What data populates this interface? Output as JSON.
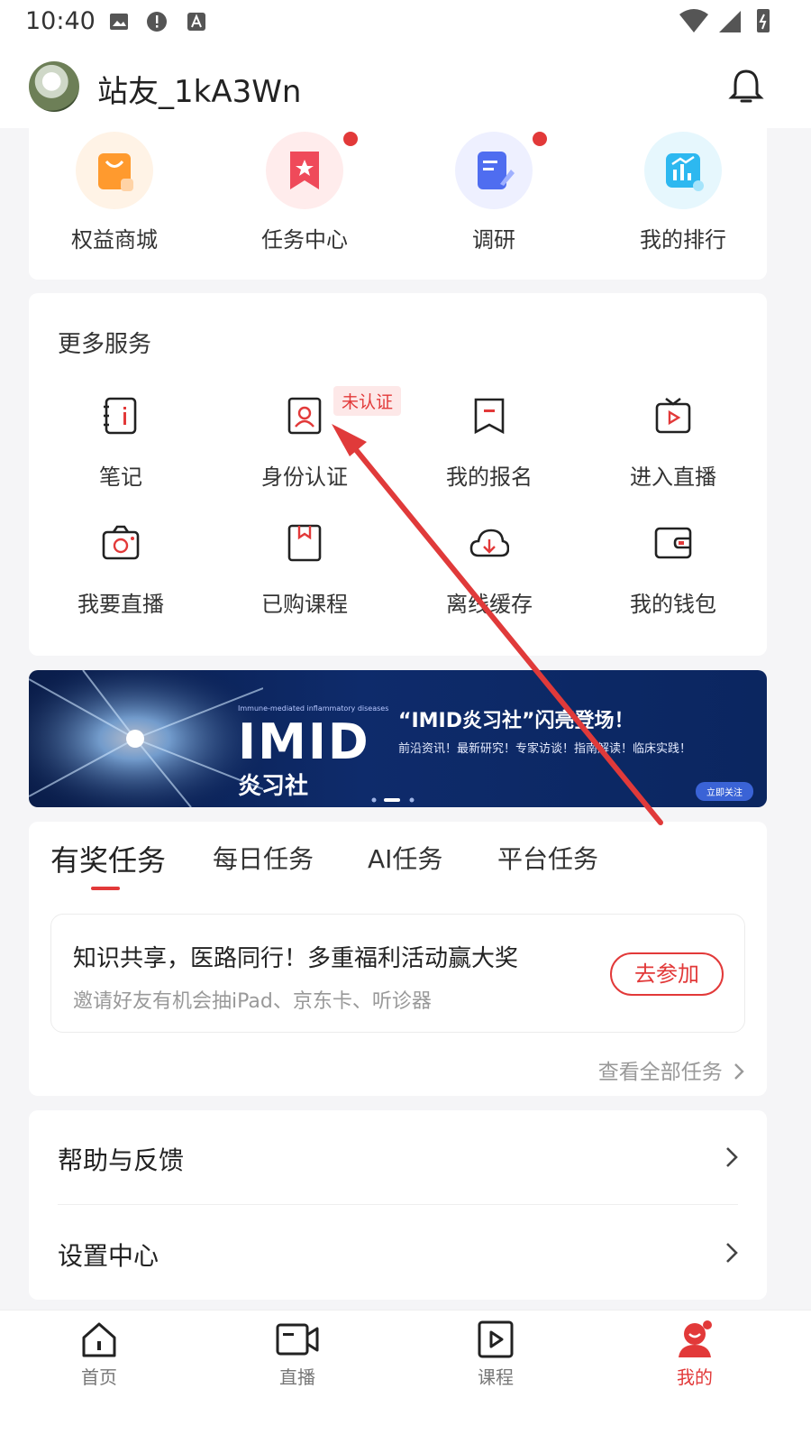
{
  "status_bar": {
    "time": "10:40"
  },
  "header": {
    "username": "站友_1kA3Wn"
  },
  "quick_actions": [
    {
      "label": "权益商城",
      "icon": "shopping-bag-icon"
    },
    {
      "label": "任务中心",
      "icon": "bookmark-star-icon"
    },
    {
      "label": "调研",
      "icon": "survey-edit-icon"
    },
    {
      "label": "我的排行",
      "icon": "ranking-chart-icon"
    }
  ],
  "more_services": {
    "title": "更多服务",
    "badge": "未认证",
    "items": [
      {
        "label": "笔记",
        "icon": "notebook-icon"
      },
      {
        "label": "身份认证",
        "icon": "id-card-icon"
      },
      {
        "label": "我的报名",
        "icon": "registration-icon"
      },
      {
        "label": "进入直播",
        "icon": "tv-play-icon"
      },
      {
        "label": "我要直播",
        "icon": "camera-icon"
      },
      {
        "label": "已购课程",
        "icon": "course-book-icon"
      },
      {
        "label": "离线缓存",
        "icon": "cloud-download-icon"
      },
      {
        "label": "我的钱包",
        "icon": "wallet-icon"
      }
    ]
  },
  "banner": {
    "top_line": "Immune-mediated inflammatory diseases",
    "logo": "IMID",
    "logo_sub": "炎习社",
    "headline": "“IMID炎习社”闪亮登场！",
    "desc": "前沿资讯！最新研究！专家访谈！指南解读！临床实践！",
    "button": "立即关注"
  },
  "tasks": {
    "tabs": [
      "有奖任务",
      "每日任务",
      "AI任务",
      "平台任务"
    ],
    "promo_title": "知识共享，医路同行！多重福利活动赢大奖",
    "promo_sub": "邀请好友有机会抽iPad、京东卡、听诊器",
    "join_button": "去参加",
    "view_all": "查看全部任务"
  },
  "settings": [
    {
      "label": "帮助与反馈"
    },
    {
      "label": "设置中心"
    }
  ],
  "nav": [
    {
      "label": "首页",
      "icon": "home-icon"
    },
    {
      "label": "直播",
      "icon": "video-camera-icon"
    },
    {
      "label": "课程",
      "icon": "play-box-icon"
    },
    {
      "label": "我的",
      "icon": "profile-icon"
    }
  ],
  "colors": {
    "accent": "#e23939",
    "banner_bg": "#0e2b6b"
  }
}
